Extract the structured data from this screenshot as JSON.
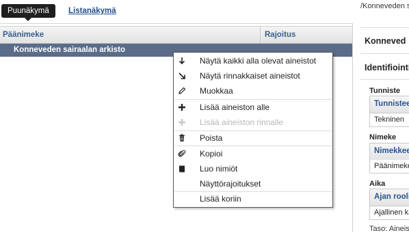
{
  "tabs": {
    "active": "Puunäkymä",
    "link": "Listanäkymä"
  },
  "grid": {
    "columns": [
      "Päänimeke",
      "Rajoitus"
    ],
    "selected_row": "Konneveden sairaalan arkisto"
  },
  "context_menu": {
    "items": [
      {
        "label": "Näytä kaikki alla olevat aineistot",
        "icon": "arrow-down-icon",
        "enabled": true
      },
      {
        "label": "Näytä rinnakkaiset aineistot",
        "icon": "arrow-down-right-icon",
        "enabled": true
      },
      {
        "label": "Muokkaa",
        "icon": "pencil-icon",
        "enabled": true
      },
      {
        "label": "Lisää aineiston alle",
        "icon": "plus-icon",
        "enabled": true
      },
      {
        "label": "Lisää aineiston rinnalle",
        "icon": "plus-icon",
        "enabled": false
      },
      {
        "label": "Poista",
        "icon": "trash-icon",
        "enabled": true
      },
      {
        "label": "Kopioi",
        "icon": "paperclip-icon",
        "enabled": true
      },
      {
        "label": "Luo nimiöt",
        "icon": "book-icon",
        "enabled": true
      },
      {
        "label": "Näyttörajoitukset",
        "icon": "",
        "enabled": true
      },
      {
        "label": "Lisää koriin",
        "icon": "",
        "enabled": true
      }
    ]
  },
  "right_panel": {
    "breadcrumb": "/Konneveden s",
    "title": "Konneved",
    "section": "Identifiointi",
    "tunniste_label": "Tunniste",
    "tunniste_header": "Tunnistee",
    "tunniste_value": "Tekninen",
    "nimeke_label": "Nimeke",
    "nimeke_header": "Nimekkee",
    "nimeke_value": "Päänimeke",
    "aika_label": "Aika",
    "aika_header": "Ajan rooli",
    "aika_value": "Ajallinen ka",
    "taso": "Taso: Aineis"
  }
}
